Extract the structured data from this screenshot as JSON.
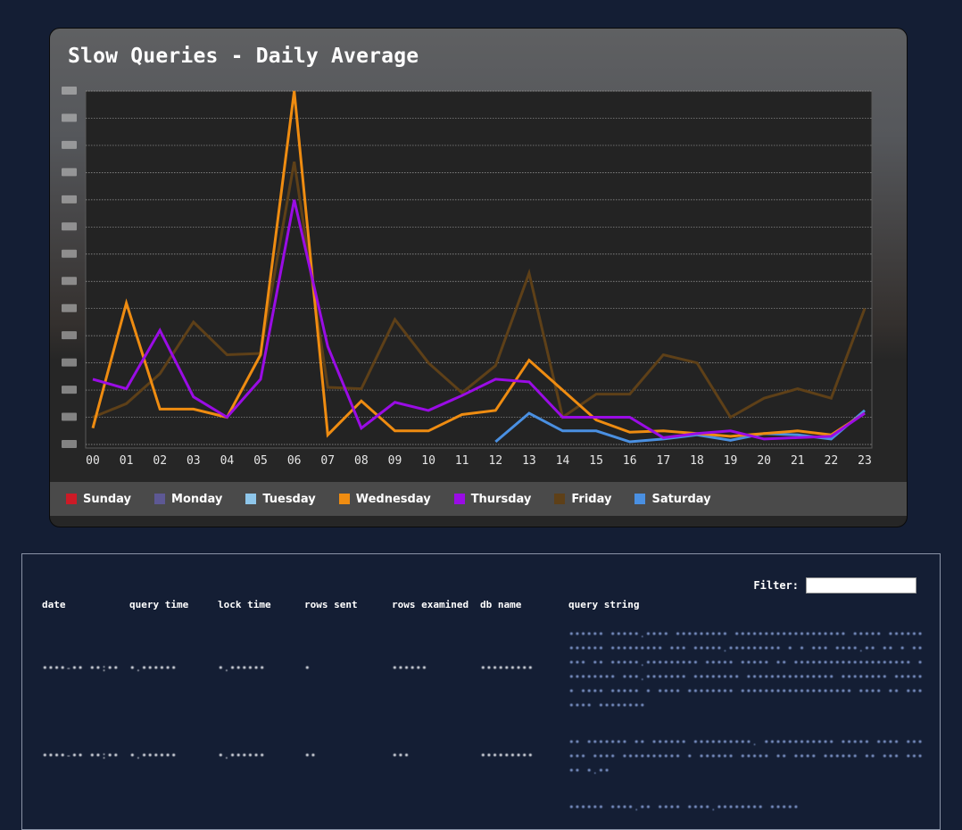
{
  "chart_data": {
    "type": "line",
    "title": "Slow Queries - Daily Average",
    "categories": [
      "00",
      "01",
      "02",
      "03",
      "04",
      "05",
      "06",
      "07",
      "08",
      "09",
      "10",
      "11",
      "12",
      "13",
      "14",
      "15",
      "16",
      "17",
      "18",
      "19",
      "20",
      "21",
      "22",
      "23"
    ],
    "ylim": [
      0,
      13
    ],
    "grid": true,
    "legend_position": "bottom",
    "series": [
      {
        "name": "Sunday",
        "color": "#cc1a26",
        "values": []
      },
      {
        "name": "Monday",
        "color": "#5d5894",
        "values": []
      },
      {
        "name": "Tuesday",
        "color": "#8ec6ea",
        "values": []
      },
      {
        "name": "Wednesday",
        "color": "#ef8c11",
        "values": [
          0.6,
          5.2,
          1.3,
          1.3,
          1.0,
          3.3,
          13.0,
          0.35,
          1.6,
          0.5,
          0.5,
          1.1,
          1.25,
          3.1,
          2.0,
          0.9,
          0.45,
          0.5,
          0.4,
          0.3,
          0.4,
          0.5,
          0.35,
          1.15
        ]
      },
      {
        "name": "Thursday",
        "color": "#9a0ce5",
        "values": [
          2.4,
          2.05,
          4.2,
          1.75,
          1.0,
          2.4,
          9.0,
          3.6,
          0.6,
          1.55,
          1.25,
          1.8,
          2.4,
          2.3,
          1.0,
          1.0,
          1.0,
          0.25,
          0.4,
          0.5,
          0.2,
          0.25,
          0.3,
          1.15
        ]
      },
      {
        "name": "Friday",
        "color": "#5e4018",
        "values": [
          1.0,
          1.5,
          2.6,
          4.5,
          3.3,
          3.35,
          10.4,
          2.1,
          2.05,
          4.6,
          3.0,
          1.9,
          2.9,
          6.3,
          1.0,
          1.85,
          1.85,
          3.3,
          3.0,
          1.0,
          1.7,
          2.05,
          1.7,
          5.0
        ]
      },
      {
        "name": "Saturday",
        "color": "#4a90e2",
        "values": [
          null,
          null,
          null,
          null,
          null,
          null,
          null,
          null,
          null,
          null,
          null,
          null,
          0.1,
          1.15,
          0.5,
          0.5,
          0.1,
          0.2,
          0.35,
          0.15,
          0.4,
          0.35,
          0.2,
          1.25
        ]
      }
    ]
  },
  "legend": [
    {
      "label": "Sunday",
      "color": "#cc1a26"
    },
    {
      "label": "Monday",
      "color": "#5d5894"
    },
    {
      "label": "Tuesday",
      "color": "#8ec6ea"
    },
    {
      "label": "Wednesday",
      "color": "#ef8c11"
    },
    {
      "label": "Thursday",
      "color": "#9a0ce5"
    },
    {
      "label": "Friday",
      "color": "#5e4018"
    },
    {
      "label": "Saturday",
      "color": "#4a90e2"
    }
  ],
  "table": {
    "filter_label": "Filter:",
    "filter_value": "",
    "headers": {
      "date": "date",
      "query_time": "query time",
      "lock_time": "lock time",
      "rows_sent": "rows sent",
      "rows_examined": "rows examined",
      "db_name": "db name",
      "query_string": "query string"
    },
    "rows": [
      {
        "date": "••••-•• ••:••",
        "query_time": "•.••••••",
        "lock_time": "•.••••••",
        "rows_sent": "•",
        "rows_examined": "••••••",
        "db_name": "•••••••••",
        "query_string": "•••••• •••••.•••• ••••••••• ••••••••••••••••••• ••••• •••••• •••••• ••••••••• ••• •••••.••••••••• • • ••• ••••.•• •• • ••••• •• •••••.••••••••• ••••• ••••• •• •••••••••••••••••••• ••••••••• •••.••••••• •••••••• ••••••••••••••• •••••••• •••••• •••• ••••• • •••• •••••••• ••••••••••••••••••• •••• •• ••••••• ••••••••"
      },
      {
        "date": "••••-•• ••:••",
        "query_time": "•.••••••",
        "lock_time": "•.••••••",
        "rows_sent": "••",
        "rows_examined": "•••",
        "db_name": "•••••••••",
        "query_string": "•• ••••••• •• •••••• ••••••••••. •••••••••••• ••••• •••• •••••• •••• •••••••••• • •••••• ••••• •• •••• •••••• •• ••• ••••• •.••"
      },
      {
        "date": "",
        "query_time": "",
        "lock_time": "",
        "rows_sent": "",
        "rows_examined": "",
        "db_name": "",
        "query_string": "•••••• ••••.•• •••• ••••.•••••••• •••••"
      }
    ]
  }
}
